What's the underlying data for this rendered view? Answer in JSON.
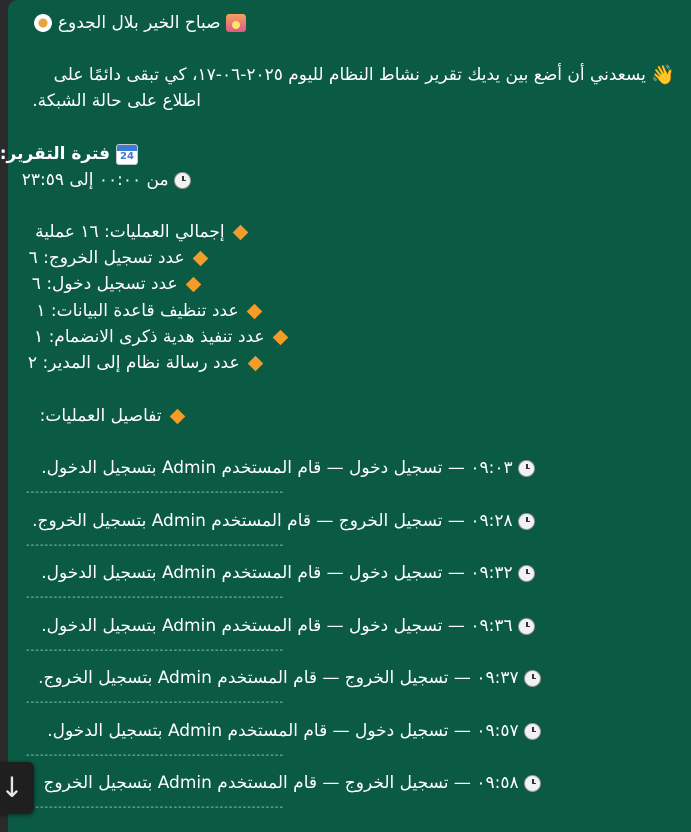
{
  "message": {
    "greeting": "صباح الخير بلال الجدوع",
    "intro_line1": "يسعدني أن أضع بين يديك تقرير نشاط النظام لليوم ٢٠٢٥-٠٦-١٧، كي تبقى دائمًا على",
    "intro_line2": "اطلاع على حالة الشبكة.",
    "period_title": "فترة التقرير:",
    "period_range": "من ٠٠:٠٠ إلى ٢٣:٥٩",
    "total_ops": "إجمالي العمليات: ١٦ عملية",
    "stats": [
      "عدد تسجيل الخروج: ٦",
      "عدد تسجيل دخول: ٦",
      "عدد تنظيف قاعدة البيانات: ١",
      "عدد تنفيذ هدية ذكرى الانضمام: ١",
      "عدد رسالة نظام إلى المدير: ٢"
    ],
    "details_title": "تفاصيل العمليات:",
    "operations": [
      "٠٩:٠٣ — تسجيل دخول — قام المستخدم Admin بتسجيل الدخول.",
      "٠٩:٢٨ — تسجيل الخروج — قام المستخدم Admin بتسجيل الخروج.",
      "٠٩:٣٢ — تسجيل دخول — قام المستخدم Admin بتسجيل الدخول.",
      "٠٩:٣٦ — تسجيل دخول — قام المستخدم Admin بتسجيل الدخول.",
      "٠٩:٣٧ — تسجيل الخروج — قام المستخدم Admin بتسجيل الخروج.",
      "٠٩:٥٧ — تسجيل دخول — قام المستخدم Admin بتسجيل الدخول.",
      "٠٩:٥٨ — تسجيل الخروج — قام المستخدم Admin بتسجيل الخروج"
    ],
    "separator": "--------------------------------------------------------"
  },
  "icons": {
    "greeting": [
      "flower-icon",
      "sunrise-icon"
    ],
    "intro": "waving-hand-icon",
    "period": "calendar-icon",
    "time": "clock-icon",
    "bullet": "orange-diamond-icon",
    "scroll": "arrow-down-icon"
  },
  "colors": {
    "bubble": "#0b5a43",
    "background": "#2b2b2b",
    "text": "#ffffff",
    "diamond": "#f39c2a"
  },
  "scroll_button": {
    "symbol": "↓"
  }
}
